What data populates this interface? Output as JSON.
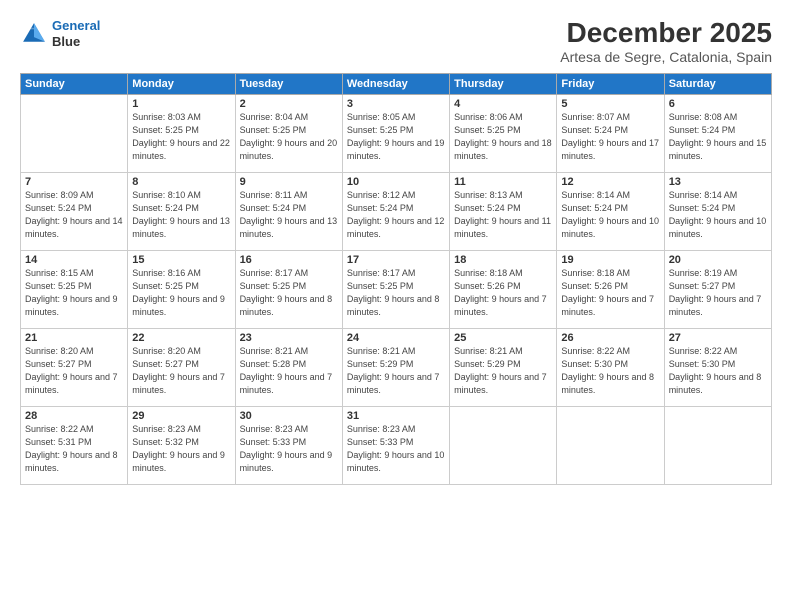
{
  "logo": {
    "line1": "General",
    "line2": "Blue"
  },
  "title": "December 2025",
  "location": "Artesa de Segre, Catalonia, Spain",
  "days_of_week": [
    "Sunday",
    "Monday",
    "Tuesday",
    "Wednesday",
    "Thursday",
    "Friday",
    "Saturday"
  ],
  "weeks": [
    [
      null,
      {
        "day": 1,
        "sunrise": "8:03 AM",
        "sunset": "5:25 PM",
        "daylight": "9 hours and 22 minutes."
      },
      {
        "day": 2,
        "sunrise": "8:04 AM",
        "sunset": "5:25 PM",
        "daylight": "9 hours and 20 minutes."
      },
      {
        "day": 3,
        "sunrise": "8:05 AM",
        "sunset": "5:25 PM",
        "daylight": "9 hours and 19 minutes."
      },
      {
        "day": 4,
        "sunrise": "8:06 AM",
        "sunset": "5:25 PM",
        "daylight": "9 hours and 18 minutes."
      },
      {
        "day": 5,
        "sunrise": "8:07 AM",
        "sunset": "5:24 PM",
        "daylight": "9 hours and 17 minutes."
      },
      {
        "day": 6,
        "sunrise": "8:08 AM",
        "sunset": "5:24 PM",
        "daylight": "9 hours and 15 minutes."
      }
    ],
    [
      {
        "day": 7,
        "sunrise": "8:09 AM",
        "sunset": "5:24 PM",
        "daylight": "9 hours and 14 minutes."
      },
      {
        "day": 8,
        "sunrise": "8:10 AM",
        "sunset": "5:24 PM",
        "daylight": "9 hours and 13 minutes."
      },
      {
        "day": 9,
        "sunrise": "8:11 AM",
        "sunset": "5:24 PM",
        "daylight": "9 hours and 13 minutes."
      },
      {
        "day": 10,
        "sunrise": "8:12 AM",
        "sunset": "5:24 PM",
        "daylight": "9 hours and 12 minutes."
      },
      {
        "day": 11,
        "sunrise": "8:13 AM",
        "sunset": "5:24 PM",
        "daylight": "9 hours and 11 minutes."
      },
      {
        "day": 12,
        "sunrise": "8:14 AM",
        "sunset": "5:24 PM",
        "daylight": "9 hours and 10 minutes."
      },
      {
        "day": 13,
        "sunrise": "8:14 AM",
        "sunset": "5:24 PM",
        "daylight": "9 hours and 10 minutes."
      }
    ],
    [
      {
        "day": 14,
        "sunrise": "8:15 AM",
        "sunset": "5:25 PM",
        "daylight": "9 hours and 9 minutes."
      },
      {
        "day": 15,
        "sunrise": "8:16 AM",
        "sunset": "5:25 PM",
        "daylight": "9 hours and 9 minutes."
      },
      {
        "day": 16,
        "sunrise": "8:17 AM",
        "sunset": "5:25 PM",
        "daylight": "9 hours and 8 minutes."
      },
      {
        "day": 17,
        "sunrise": "8:17 AM",
        "sunset": "5:25 PM",
        "daylight": "9 hours and 8 minutes."
      },
      {
        "day": 18,
        "sunrise": "8:18 AM",
        "sunset": "5:26 PM",
        "daylight": "9 hours and 7 minutes."
      },
      {
        "day": 19,
        "sunrise": "8:18 AM",
        "sunset": "5:26 PM",
        "daylight": "9 hours and 7 minutes."
      },
      {
        "day": 20,
        "sunrise": "8:19 AM",
        "sunset": "5:27 PM",
        "daylight": "9 hours and 7 minutes."
      }
    ],
    [
      {
        "day": 21,
        "sunrise": "8:20 AM",
        "sunset": "5:27 PM",
        "daylight": "9 hours and 7 minutes."
      },
      {
        "day": 22,
        "sunrise": "8:20 AM",
        "sunset": "5:27 PM",
        "daylight": "9 hours and 7 minutes."
      },
      {
        "day": 23,
        "sunrise": "8:21 AM",
        "sunset": "5:28 PM",
        "daylight": "9 hours and 7 minutes."
      },
      {
        "day": 24,
        "sunrise": "8:21 AM",
        "sunset": "5:29 PM",
        "daylight": "9 hours and 7 minutes."
      },
      {
        "day": 25,
        "sunrise": "8:21 AM",
        "sunset": "5:29 PM",
        "daylight": "9 hours and 7 minutes."
      },
      {
        "day": 26,
        "sunrise": "8:22 AM",
        "sunset": "5:30 PM",
        "daylight": "9 hours and 8 minutes."
      },
      {
        "day": 27,
        "sunrise": "8:22 AM",
        "sunset": "5:30 PM",
        "daylight": "9 hours and 8 minutes."
      }
    ],
    [
      {
        "day": 28,
        "sunrise": "8:22 AM",
        "sunset": "5:31 PM",
        "daylight": "9 hours and 8 minutes."
      },
      {
        "day": 29,
        "sunrise": "8:23 AM",
        "sunset": "5:32 PM",
        "daylight": "9 hours and 9 minutes."
      },
      {
        "day": 30,
        "sunrise": "8:23 AM",
        "sunset": "5:33 PM",
        "daylight": "9 hours and 9 minutes."
      },
      {
        "day": 31,
        "sunrise": "8:23 AM",
        "sunset": "5:33 PM",
        "daylight": "9 hours and 10 minutes."
      },
      null,
      null,
      null
    ]
  ]
}
